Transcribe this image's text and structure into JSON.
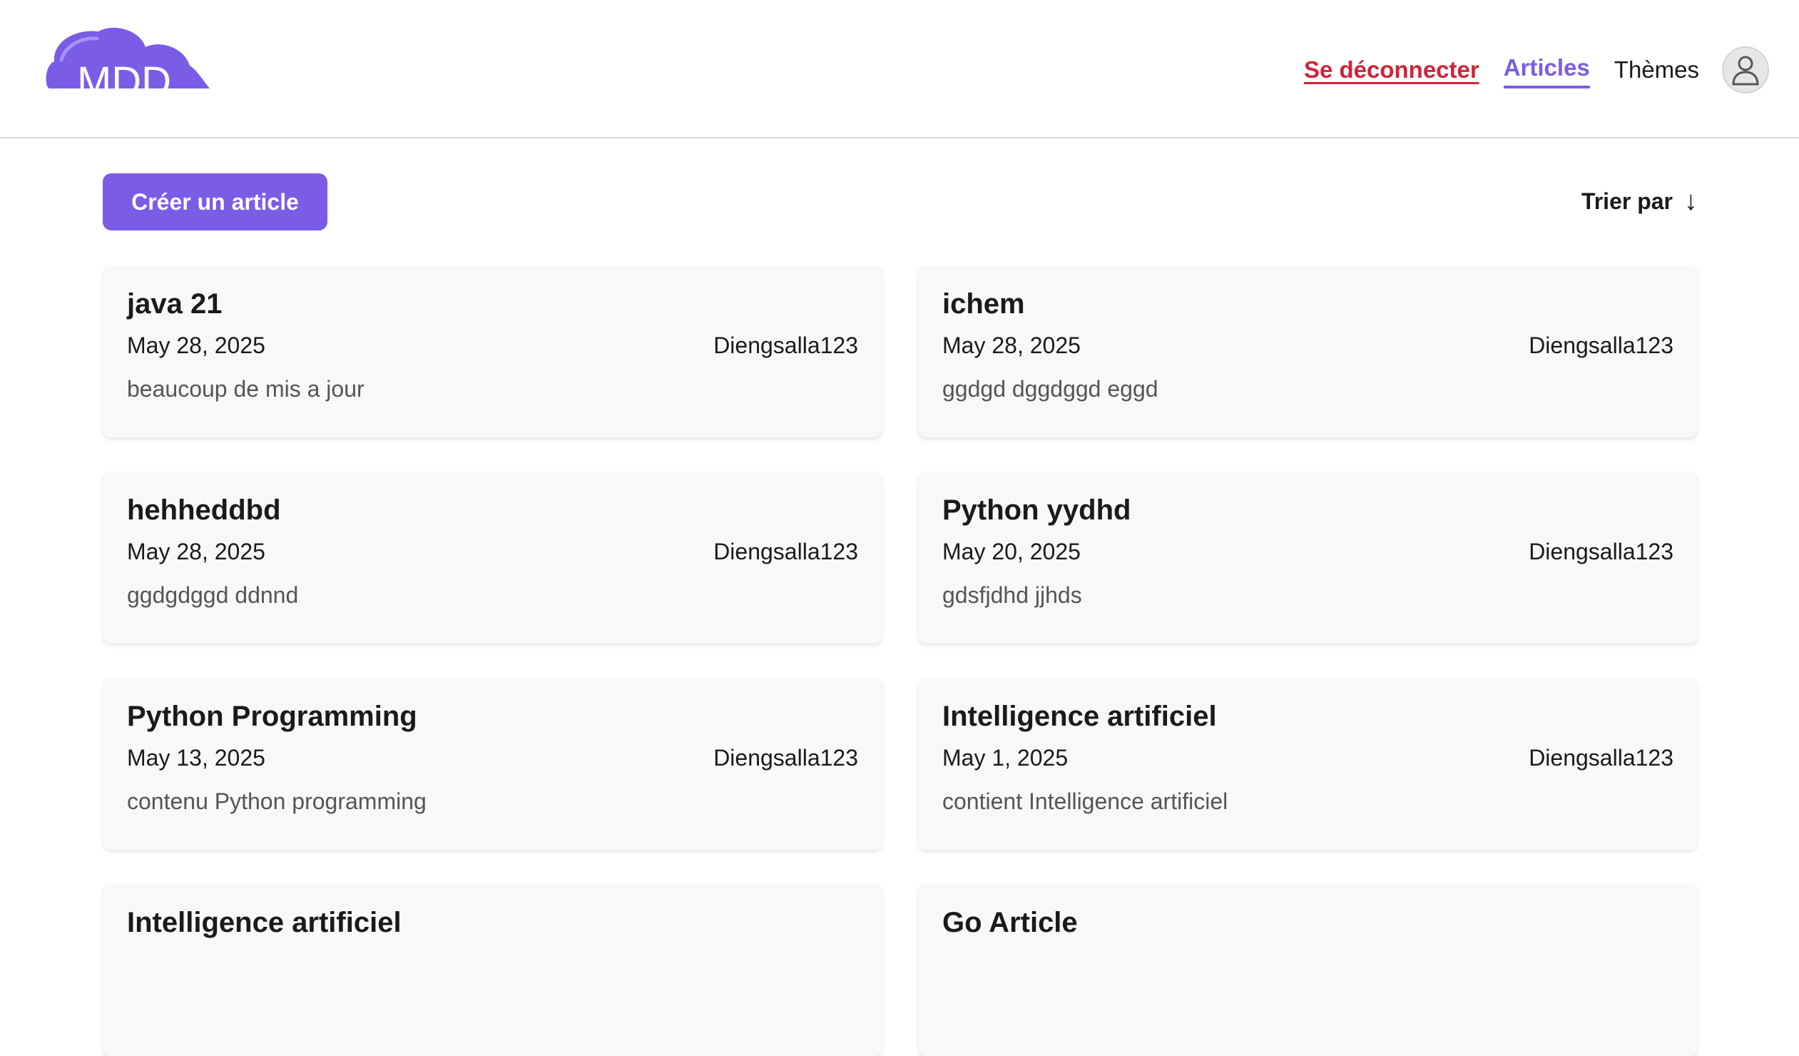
{
  "header": {
    "logo_text": "MDD",
    "nav": {
      "logout": "Se déconnecter",
      "articles": "Articles",
      "themes": "Thèmes"
    }
  },
  "toolbar": {
    "create_label": "Créer un article",
    "sort_label": "Trier par",
    "sort_arrow": "↓"
  },
  "colors": {
    "accent": "#7b5ce6",
    "logout": "#d0233a"
  },
  "articles": [
    {
      "title": "java 21",
      "date": "May 28, 2025",
      "author": "Diengsalla123",
      "content": "beaucoup de mis a jour"
    },
    {
      "title": "ichem",
      "date": "May 28, 2025",
      "author": "Diengsalla123",
      "content": "ggdgd dggdggd eggd"
    },
    {
      "title": "hehheddbd",
      "date": "May 28, 2025",
      "author": "Diengsalla123",
      "content": "ggdgdggd ddnnd"
    },
    {
      "title": "Python yydhd",
      "date": "May 20, 2025",
      "author": "Diengsalla123",
      "content": "gdsfjdhd jjhds"
    },
    {
      "title": "Python Programming",
      "date": "May 13, 2025",
      "author": "Diengsalla123",
      "content": "contenu Python programming"
    },
    {
      "title": "Intelligence artificiel",
      "date": "May 1, 2025",
      "author": "Diengsalla123",
      "content": "contient Intelligence artificiel"
    },
    {
      "title": "Intelligence artificiel",
      "date": "",
      "author": "",
      "content": ""
    },
    {
      "title": "Go Article",
      "date": "",
      "author": "",
      "content": ""
    }
  ]
}
